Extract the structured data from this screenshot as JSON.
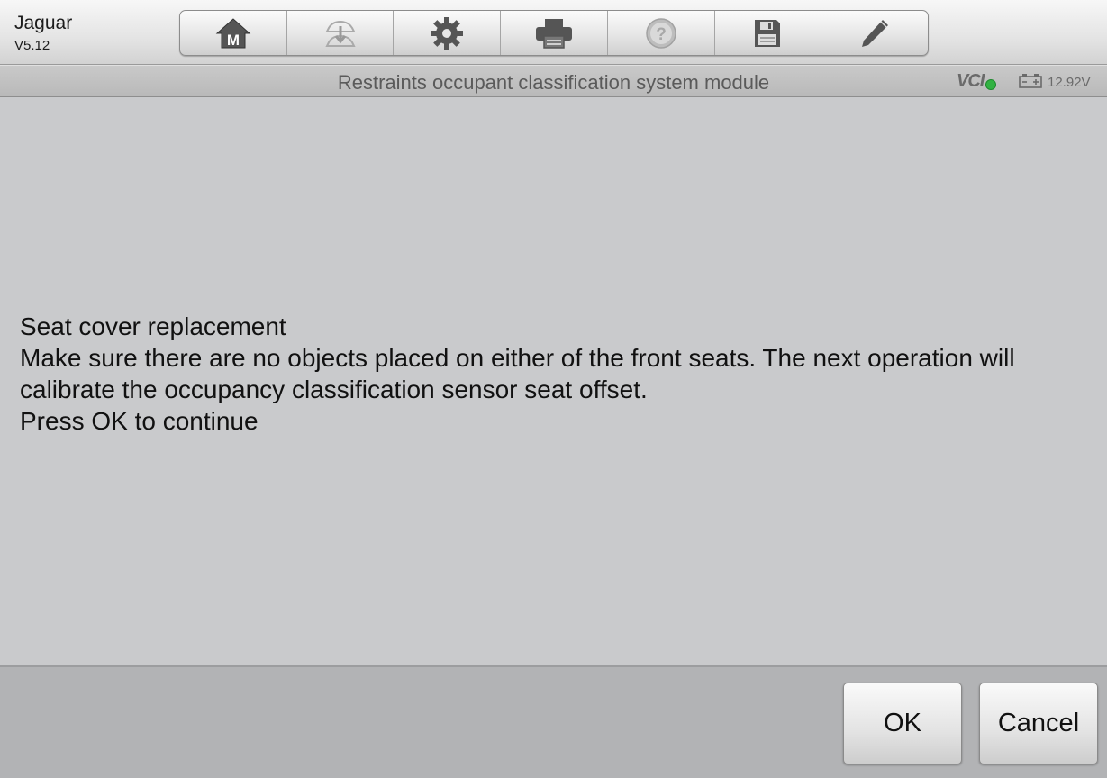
{
  "app": {
    "title": "Jaguar",
    "version": "V5.12"
  },
  "toolbar": {
    "buttons": [
      {
        "icon": "home-icon",
        "label": "M"
      },
      {
        "icon": "vehicle-swap-icon"
      },
      {
        "icon": "gear-icon"
      },
      {
        "icon": "printer-icon"
      },
      {
        "icon": "help-icon"
      },
      {
        "icon": "save-icon"
      },
      {
        "icon": "pencil-icon"
      }
    ]
  },
  "header": {
    "module_title": "Restraints occupant classification system module",
    "vci_label": "VCI",
    "vci_status_color": "#33b243",
    "battery_voltage": "12.92V"
  },
  "message": {
    "line1": "Seat cover replacement",
    "line2": "Make sure there are no objects placed on either of the front seats.  The next operation will calibrate the occupancy classification sensor seat offset.",
    "line3": "Press OK to continue"
  },
  "footer": {
    "ok_label": "OK",
    "cancel_label": "Cancel"
  }
}
